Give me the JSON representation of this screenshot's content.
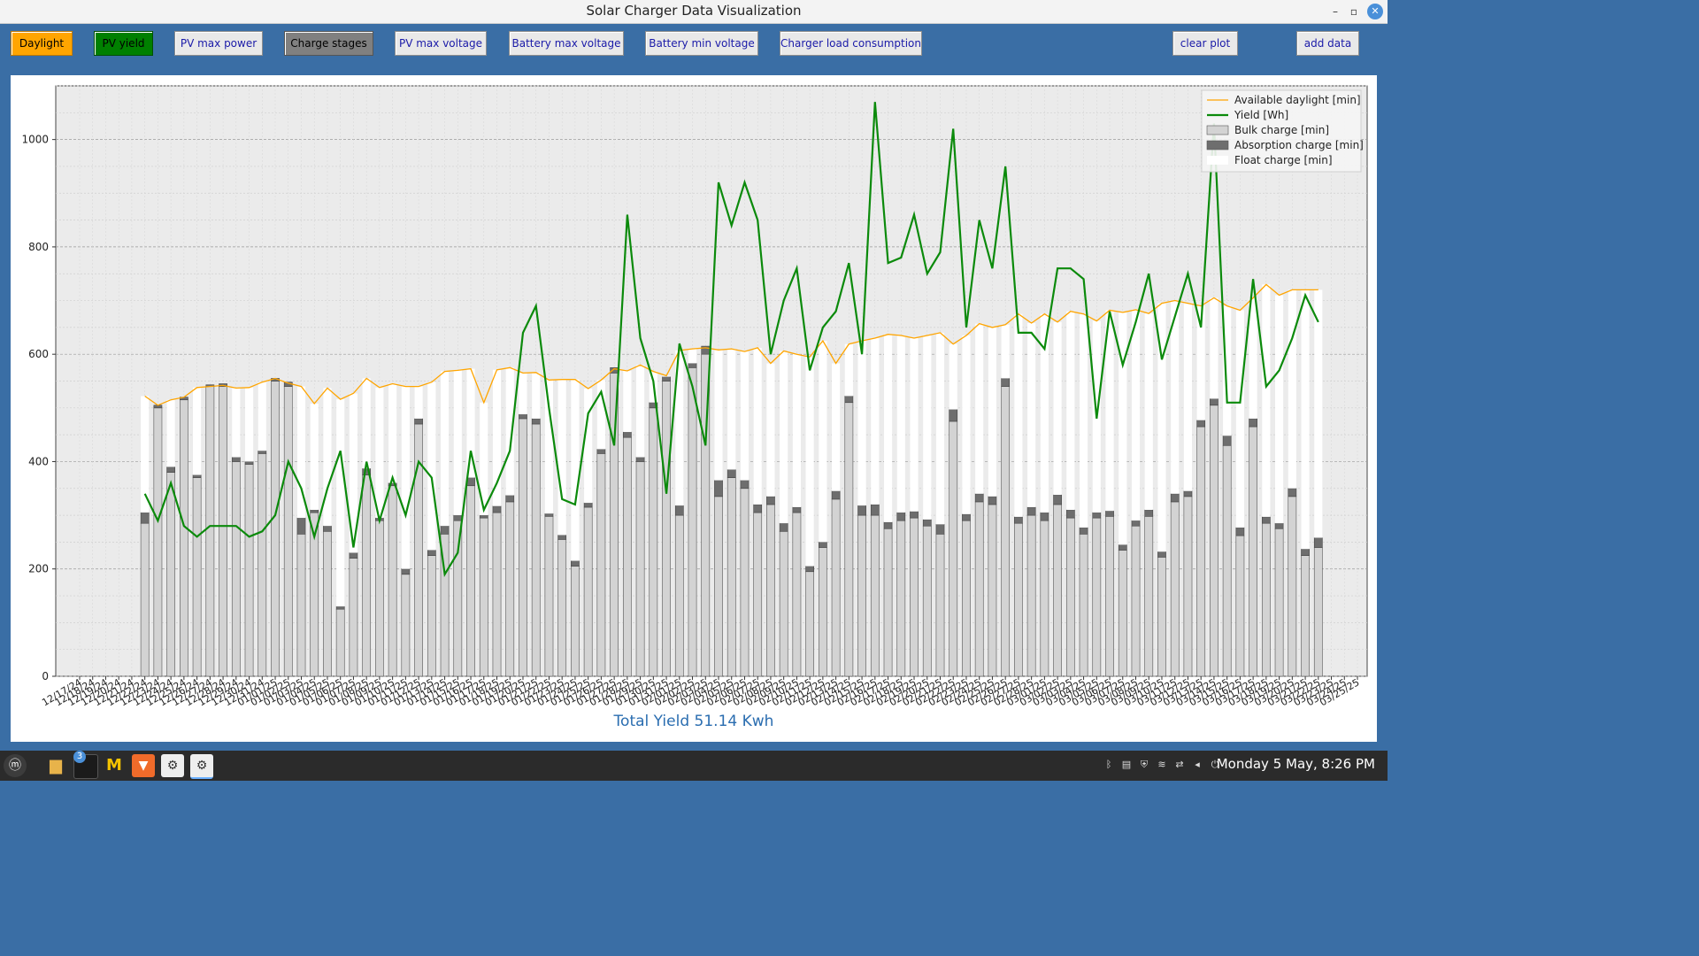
{
  "window": {
    "title": "Solar Charger Data Visualization",
    "minimize": "–",
    "maximize": "▫",
    "close": "✕"
  },
  "toolbar": {
    "daylight": "Daylight",
    "pv_yield": "PV yield",
    "pv_max_power": "PV max power",
    "charge_stages": "Charge stages",
    "pv_max_voltage": "PV max voltage",
    "battery_max_voltage": "Battery max voltage",
    "battery_min_voltage": "Battery min voltage",
    "charger_load": "Charger load consumption",
    "clear_plot": "clear plot",
    "add_data": "add data"
  },
  "footer": {
    "total_yield": "Total Yield 51.14 Kwh"
  },
  "taskbar": {
    "clock": "Monday 5 May, 8:26 PM",
    "badge": "3",
    "icons": [
      "mint-menu-icon",
      "folder-icon",
      "terminal-icon",
      "mail-icon",
      "brave-icon",
      "settings-icon",
      "settings-icon-active"
    ]
  },
  "colors": {
    "daylight": "#ffa500",
    "yield": "#0b8a0b",
    "bulk": "#d3d3d3",
    "absorption": "#6e6e6e",
    "float": "#ffffff",
    "bg": "#3a6ea5"
  },
  "chart_data": {
    "type": "bar",
    "title": "",
    "xlabel": "",
    "ylabel": "",
    "ylim": [
      0,
      1100
    ],
    "yticks": [
      0,
      200,
      400,
      600,
      800,
      1000
    ],
    "grid": true,
    "legend_position": "top-right",
    "x": [
      "12/17/24",
      "12/18/24",
      "12/19/24",
      "12/20/24",
      "12/21/24",
      "12/22/24",
      "12/23/24",
      "12/24/24",
      "12/25/24",
      "12/26/24",
      "12/27/24",
      "12/28/24",
      "12/29/24",
      "12/30/24",
      "12/31/24",
      "01/01/25",
      "01/02/25",
      "01/03/25",
      "01/04/25",
      "01/05/25",
      "01/06/25",
      "01/07/25",
      "01/08/25",
      "01/09/25",
      "01/10/25",
      "01/11/25",
      "01/12/25",
      "01/13/25",
      "01/14/25",
      "01/15/25",
      "01/16/25",
      "01/17/25",
      "01/18/25",
      "01/19/25",
      "01/20/25",
      "01/21/25",
      "01/22/25",
      "01/23/25",
      "01/24/25",
      "01/25/25",
      "01/26/25",
      "01/27/25",
      "01/28/25",
      "01/29/25",
      "01/30/25",
      "01/31/25",
      "02/01/25",
      "02/02/25",
      "02/03/25",
      "02/04/25",
      "02/05/25",
      "02/06/25",
      "02/07/25",
      "02/08/25",
      "02/09/25",
      "02/10/25",
      "02/11/25",
      "02/12/25",
      "02/13/25",
      "02/14/25",
      "02/15/25",
      "02/16/25",
      "02/17/25",
      "02/18/25",
      "02/19/25",
      "02/20/25",
      "02/21/25",
      "02/22/25",
      "02/23/25",
      "02/24/25",
      "02/25/25",
      "02/26/25",
      "02/27/25",
      "02/28/25",
      "03/01/25",
      "03/02/25",
      "03/03/25",
      "03/04/25",
      "03/05/25",
      "03/06/25",
      "03/07/25",
      "03/08/25",
      "03/09/25",
      "03/10/25",
      "03/11/25",
      "03/12/25",
      "03/13/25",
      "03/14/25",
      "03/15/25",
      "03/16/25",
      "03/17/25",
      "03/18/25",
      "03/19/25",
      "03/20/25",
      "03/21/25",
      "03/22/25",
      "03/23/25",
      "03/24/25",
      "03/25/25"
    ],
    "series": [
      {
        "name": "Available daylight [min]",
        "kind": "line",
        "color": "#ffa500",
        "values": [
          null,
          null,
          null,
          null,
          null,
          522,
          505,
          515,
          520,
          538,
          540,
          542,
          537,
          538,
          548,
          555,
          546,
          540,
          508,
          537,
          516,
          527,
          555,
          538,
          545,
          540,
          540,
          548,
          568,
          570,
          573,
          510,
          571,
          575,
          565,
          566,
          552,
          553,
          553,
          536,
          552,
          573,
          569,
          580,
          568,
          560,
          607,
          610,
          612,
          608,
          610,
          605,
          612,
          583,
          606,
          600,
          595,
          625,
          583,
          619,
          625,
          630,
          637,
          635,
          630,
          635,
          640,
          619,
          635,
          657,
          650,
          655,
          675,
          658,
          675,
          660,
          680,
          675,
          662,
          682,
          678,
          683,
          676,
          695,
          700,
          695,
          690,
          705,
          690,
          682,
          705,
          730,
          710,
          720,
          720,
          720,
          null,
          null,
          null
        ]
      },
      {
        "name": "Yield [Wh]",
        "kind": "line",
        "color": "#0b8a0b",
        "values": [
          null,
          null,
          null,
          null,
          null,
          340,
          290,
          360,
          280,
          260,
          280,
          280,
          280,
          260,
          270,
          300,
          400,
          350,
          260,
          350,
          420,
          240,
          400,
          290,
          370,
          300,
          400,
          370,
          190,
          230,
          420,
          310,
          360,
          420,
          640,
          690,
          500,
          330,
          320,
          490,
          530,
          430,
          860,
          630,
          550,
          340,
          620,
          540,
          430,
          920,
          840,
          920,
          850,
          600,
          700,
          760,
          570,
          650,
          680,
          770,
          600,
          1070,
          770,
          780,
          860,
          750,
          790,
          1020,
          650,
          850,
          760,
          950,
          640,
          640,
          610,
          760,
          760,
          740,
          480,
          680,
          580,
          660,
          750,
          590,
          670,
          750,
          650,
          1030,
          510,
          510,
          740,
          540,
          570,
          630,
          710,
          660,
          null,
          null,
          null
        ]
      },
      {
        "name": "Bulk charge [min]",
        "kind": "bar",
        "color": "#d3d3d3",
        "values": [
          null,
          null,
          null,
          null,
          null,
          285,
          500,
          380,
          515,
          370,
          540,
          540,
          400,
          395,
          415,
          550,
          540,
          265,
          305,
          270,
          125,
          220,
          375,
          290,
          355,
          190,
          470,
          225,
          265,
          290,
          355,
          295,
          305,
          325,
          480,
          470,
          298,
          255,
          205,
          315,
          415,
          565,
          445,
          400,
          500,
          550,
          300,
          575,
          600,
          335,
          370,
          350,
          305,
          320,
          270,
          305,
          195,
          240,
          330,
          510,
          300,
          300,
          275,
          290,
          295,
          280,
          265,
          475,
          290,
          325,
          320,
          540,
          285,
          300,
          290,
          320,
          295,
          265,
          295,
          298,
          235,
          280,
          298,
          222,
          325,
          335,
          465,
          505,
          430,
          262,
          465,
          285,
          275,
          335,
          225,
          240,
          null,
          null,
          null
        ]
      },
      {
        "name": "Absorption charge [min]",
        "kind": "bar",
        "color": "#6e6e6e",
        "values": [
          null,
          null,
          null,
          null,
          null,
          20,
          5,
          10,
          5,
          5,
          3,
          5,
          8,
          5,
          5,
          5,
          8,
          30,
          5,
          10,
          5,
          10,
          12,
          5,
          5,
          10,
          10,
          10,
          15,
          10,
          15,
          5,
          12,
          12,
          8,
          10,
          5,
          8,
          10,
          8,
          8,
          10,
          10,
          8,
          10,
          8,
          18,
          8,
          15,
          30,
          15,
          15,
          15,
          15,
          15,
          10,
          10,
          10,
          15,
          12,
          18,
          20,
          12,
          15,
          12,
          12,
          18,
          22,
          12,
          15,
          15,
          15,
          12,
          15,
          15,
          18,
          15,
          12,
          10,
          10,
          10,
          10,
          12,
          10,
          15,
          10,
          12,
          12,
          18,
          15,
          15,
          12,
          10,
          15,
          12,
          18,
          null,
          null,
          null
        ]
      },
      {
        "name": "Float charge [min]",
        "kind": "bar",
        "color": "#ffffff",
        "values": [
          null,
          null,
          null,
          null,
          null,
          217,
          0,
          125,
          0,
          163,
          0,
          0,
          129,
          138,
          128,
          0,
          0,
          245,
          198,
          257,
          386,
          297,
          168,
          243,
          185,
          340,
          60,
          313,
          288,
          270,
          203,
          210,
          254,
          238,
          77,
          86,
          249,
          290,
          338,
          213,
          129,
          0,
          114,
          172,
          58,
          2,
          289,
          27,
          0,
          243,
          225,
          240,
          292,
          248,
          321,
          285,
          390,
          375,
          238,
          97,
          307,
          310,
          350,
          330,
          323,
          343,
          357,
          122,
          333,
          317,
          315,
          100,
          378,
          343,
          370,
          322,
          370,
          398,
          357,
          374,
          433,
          393,
          366,
          463,
          360,
          350,
          213,
          188,
          242,
          405,
          225,
          433,
          425,
          370,
          483,
          462,
          null,
          null,
          null
        ]
      }
    ]
  }
}
